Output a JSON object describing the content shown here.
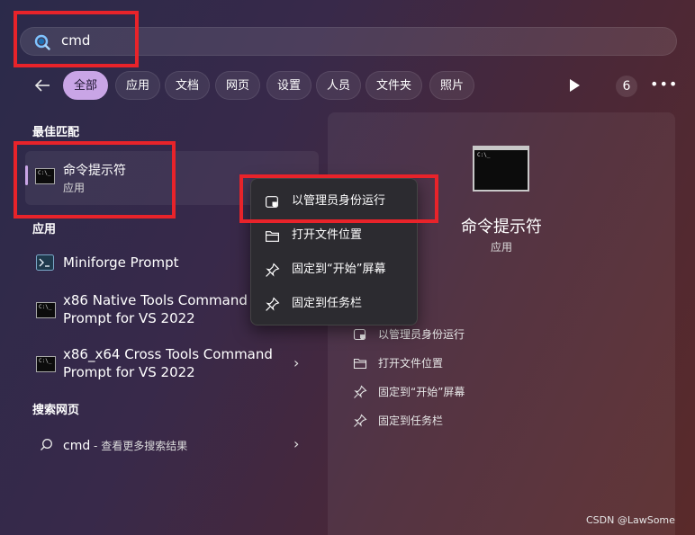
{
  "search": {
    "value": "cmd"
  },
  "filters": {
    "back_icon": "arrow-left-icon",
    "chips": [
      "全部",
      "应用",
      "文档",
      "网页",
      "设置",
      "人员",
      "文件夹",
      "照片"
    ],
    "count": "6",
    "more_icon": "ellipsis-icon",
    "play_icon": "play-icon"
  },
  "best_match": {
    "heading": "最佳匹配",
    "title": "命令提示符",
    "subtitle": "应用"
  },
  "apps": {
    "heading": "应用",
    "items": [
      {
        "label": "Miniforge Prompt"
      },
      {
        "label_line1": "x86 Native Tools Command",
        "label_line2": "Prompt for VS 2022"
      },
      {
        "label_line1": "x86_x64 Cross Tools Command",
        "label_line2": "Prompt for VS 2022"
      }
    ]
  },
  "web": {
    "heading": "搜索网页",
    "query": "cmd",
    "suffix": " - 查看更多搜索结果"
  },
  "context_menu": {
    "items": [
      {
        "label": "以管理员身份运行",
        "icon": "shield-icon"
      },
      {
        "label": "打开文件位置",
        "icon": "folder-icon"
      },
      {
        "label": "固定到“开始”屏幕",
        "icon": "pin-icon"
      },
      {
        "label": "固定到任务栏",
        "icon": "pin-icon"
      }
    ]
  },
  "preview": {
    "title": "命令提示符",
    "subtitle": "应用",
    "icon_text": "C:\\_",
    "actions": [
      {
        "label": "以管理员身份运行",
        "icon": "shield-icon"
      },
      {
        "label": "打开文件位置",
        "icon": "folder-icon"
      },
      {
        "label": "固定到“开始”屏幕",
        "icon": "pin-icon"
      },
      {
        "label": "固定到任务栏",
        "icon": "pin-icon"
      }
    ]
  },
  "watermark": "CSDN @LawSome",
  "colors": {
    "accent": "#c9a5e6",
    "highlight": "#e8232a",
    "chip_active": "#c9a5e6"
  }
}
